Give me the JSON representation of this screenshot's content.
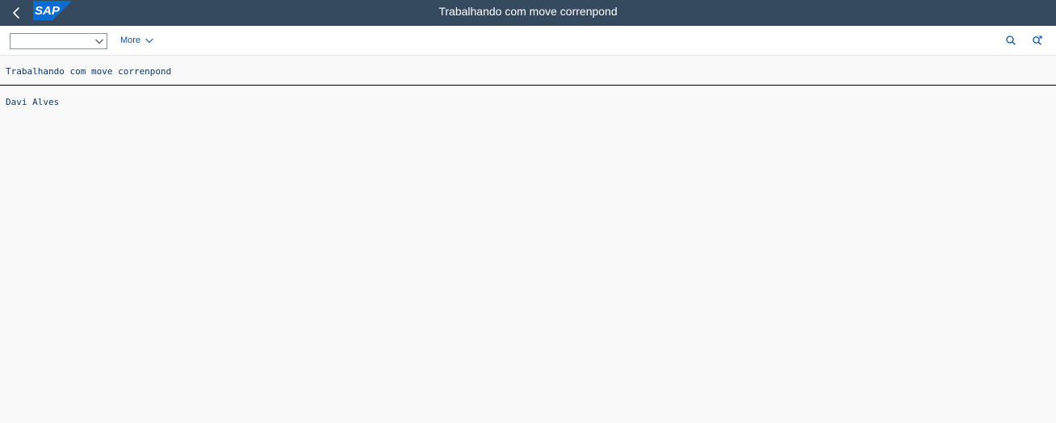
{
  "shell": {
    "title": "Trabalhando com move correnpond",
    "logo_text": "SAP",
    "colors": {
      "shell_bg": "#354a5f",
      "logo_blue": "#0a6ed1",
      "link": "#0854a0"
    },
    "icons": {
      "back": "chevron-left-icon",
      "logo": "sap-logo"
    }
  },
  "toolbar": {
    "select_value": "",
    "more_label": "More",
    "icons": {
      "find": "search-icon",
      "find_next": "search-next-icon"
    }
  },
  "list": {
    "header": "Trabalhando com move correnpond",
    "lines": [
      "Davi Alves"
    ]
  }
}
